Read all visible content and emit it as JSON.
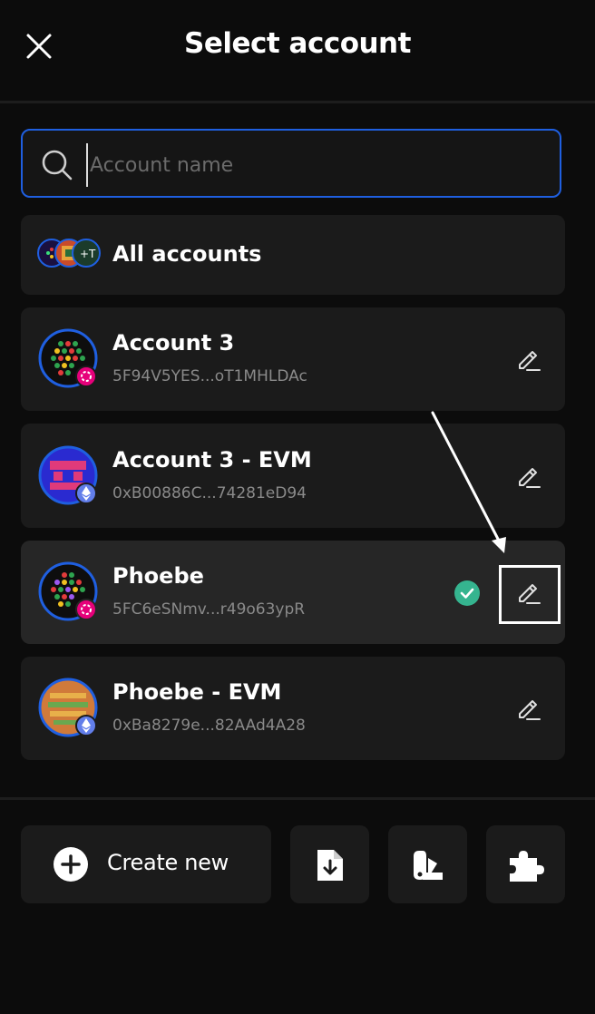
{
  "header": {
    "title": "Select account"
  },
  "search": {
    "placeholder": "Account name",
    "value": ""
  },
  "all_accounts": {
    "label": "All accounts"
  },
  "accounts": [
    {
      "name": "Account 3",
      "address": "5F94V5YES...oT1MHLDAc",
      "network": "polkadot",
      "selected": false
    },
    {
      "name": "Account 3 - EVM",
      "address": "0xB00886C...74281eD94",
      "network": "ethereum",
      "selected": false
    },
    {
      "name": "Phoebe",
      "address": "5FC6eSNmv...r49o63ypR",
      "network": "polkadot",
      "selected": true
    },
    {
      "name": "Phoebe - EVM",
      "address": "0xBa8279e...82AAd4A28",
      "network": "ethereum",
      "selected": false
    }
  ],
  "footer": {
    "create_label": "Create new",
    "icons": [
      "import-file-icon",
      "swatch-icon",
      "puzzle-extension-icon"
    ]
  },
  "colors": {
    "accent": "#1f5fe0",
    "polkadot": "#e6007a",
    "ethereum": "#627eea",
    "check": "#35b48f",
    "card": "#1b1b1b",
    "background": "#0c0c0c"
  }
}
